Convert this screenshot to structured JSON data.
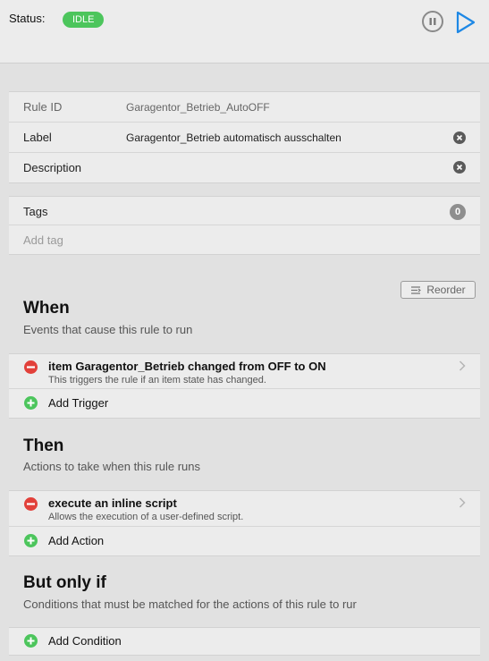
{
  "status": {
    "label": "Status:",
    "value": "IDLE"
  },
  "controls": {
    "pause_icon": "pause-circle-icon",
    "play_icon": "play-icon"
  },
  "fields": {
    "rule_id": {
      "label": "Rule ID",
      "value": "Garagentor_Betrieb_AutoOFF"
    },
    "label": {
      "label": "Label",
      "value": "Garagentor_Betrieb automatisch ausschalten"
    },
    "description": {
      "label": "Description",
      "value": ""
    }
  },
  "tags": {
    "label": "Tags",
    "count": "0",
    "add_placeholder": "Add tag"
  },
  "reorder_label": "Reorder",
  "when": {
    "title": "When",
    "subtitle": "Events that cause this rule to run",
    "modules": [
      {
        "title": "item Garagentor_Betrieb changed from OFF to ON",
        "description": "This triggers the rule if an item state has changed."
      }
    ],
    "add_label": "Add Trigger"
  },
  "then": {
    "title": "Then",
    "subtitle": "Actions to take when this rule runs",
    "modules": [
      {
        "title": "execute an inline script",
        "description": "Allows the execution of a user-defined script."
      }
    ],
    "add_label": "Add Action"
  },
  "but_only_if": {
    "title": "But only if",
    "subtitle": "Conditions that must be matched for the actions of this rule to rur",
    "add_label": "Add Condition"
  },
  "colors": {
    "idle_badge": "#4cc55c",
    "remove": "#e2403a",
    "add": "#4cc55c",
    "play": "#1e88e5"
  }
}
